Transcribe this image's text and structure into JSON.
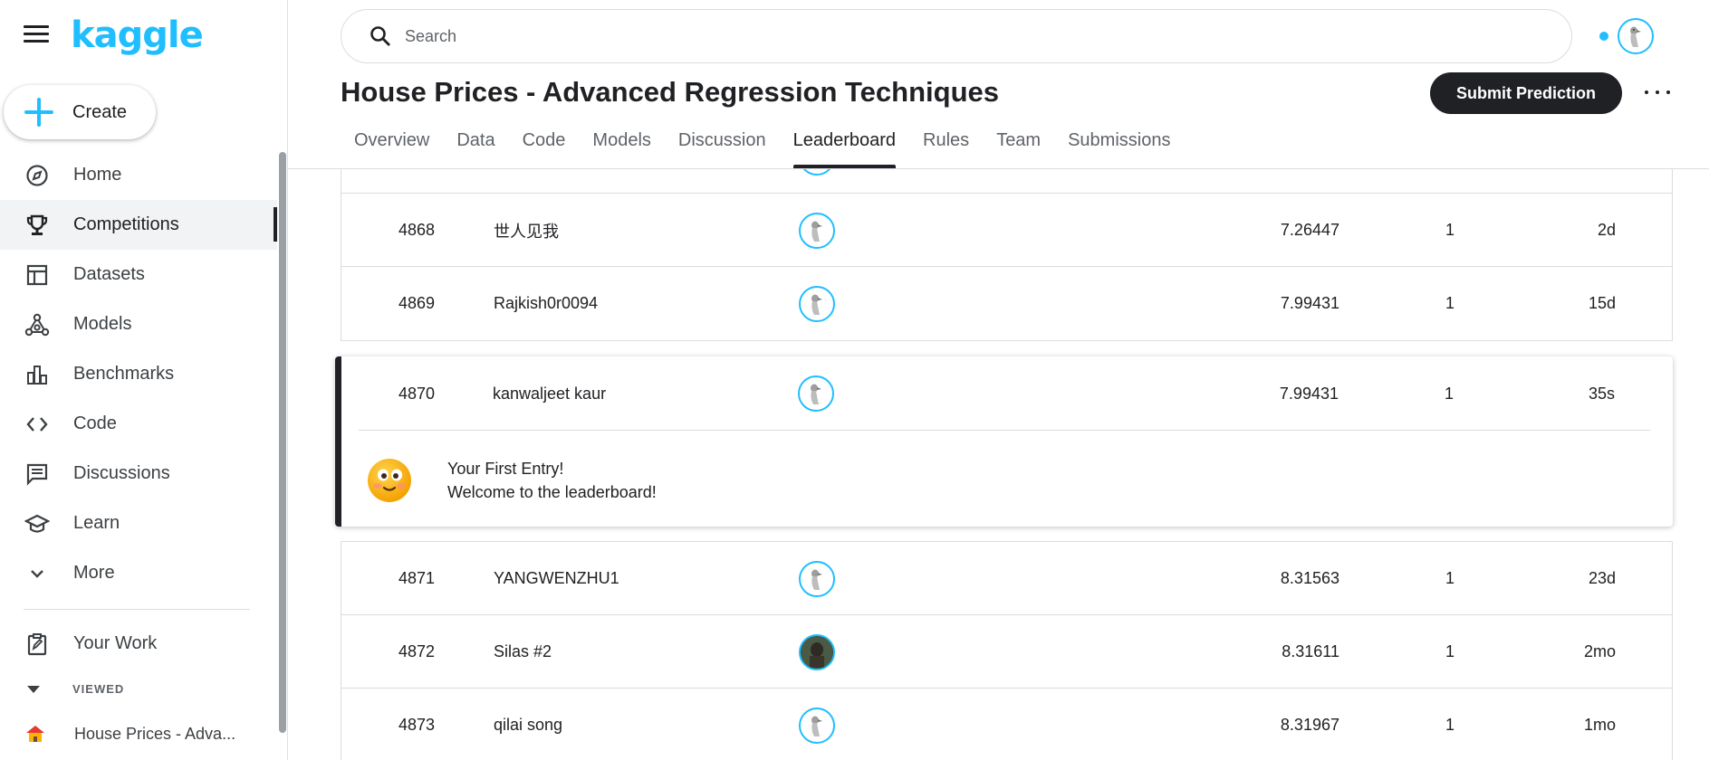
{
  "sidebar": {
    "logo": "kaggle",
    "create_label": "Create",
    "items": [
      {
        "label": "Home",
        "icon": "compass-icon",
        "active": false
      },
      {
        "label": "Competitions",
        "icon": "trophy-icon",
        "active": true
      },
      {
        "label": "Datasets",
        "icon": "table-icon",
        "active": false
      },
      {
        "label": "Models",
        "icon": "models-icon",
        "active": false
      },
      {
        "label": "Benchmarks",
        "icon": "bar-chart-icon",
        "active": false
      },
      {
        "label": "Code",
        "icon": "code-icon",
        "active": false
      },
      {
        "label": "Discussions",
        "icon": "comment-icon",
        "active": false
      },
      {
        "label": "Learn",
        "icon": "school-icon",
        "active": false
      },
      {
        "label": "More",
        "icon": "chevron-down-icon",
        "active": false
      }
    ],
    "your_work": "Your Work",
    "viewed_header": "VIEWED",
    "viewed_items": [
      "House Prices - Adva..."
    ]
  },
  "header": {
    "search_placeholder": "Search"
  },
  "competition": {
    "title": "House Prices - Advanced Regression Techniques",
    "submit_label": "Submit Prediction",
    "tabs": [
      "Overview",
      "Data",
      "Code",
      "Models",
      "Discussion",
      "Leaderboard",
      "Rules",
      "Team",
      "Submissions"
    ],
    "active_tab": "Leaderboard"
  },
  "leaderboard": {
    "rows_above": [
      {
        "rank": "4868",
        "team": "世人见我",
        "score": "7.26447",
        "entries": "1",
        "last": "2d"
      },
      {
        "rank": "4869",
        "team": "Rajkish0r0094",
        "score": "7.99431",
        "entries": "1",
        "last": "15d"
      }
    ],
    "highlight": {
      "rank": "4870",
      "team": "kanwaljeet kaur",
      "score": "7.99431",
      "entries": "1",
      "last": "35s",
      "message_title": "Your First Entry!",
      "message_body": "Welcome to the leaderboard!"
    },
    "rows_below": [
      {
        "rank": "4871",
        "team": "YANGWENZHU1",
        "score": "8.31563",
        "entries": "1",
        "last": "23d"
      },
      {
        "rank": "4872",
        "team": "Silas #2",
        "score": "8.31611",
        "entries": "1",
        "last": "2mo"
      },
      {
        "rank": "4873",
        "team": "qilai song",
        "score": "8.31967",
        "entries": "1",
        "last": "1mo"
      }
    ]
  },
  "colors": {
    "brand": "#20beff",
    "dark": "#202124",
    "border": "#dadce0"
  }
}
